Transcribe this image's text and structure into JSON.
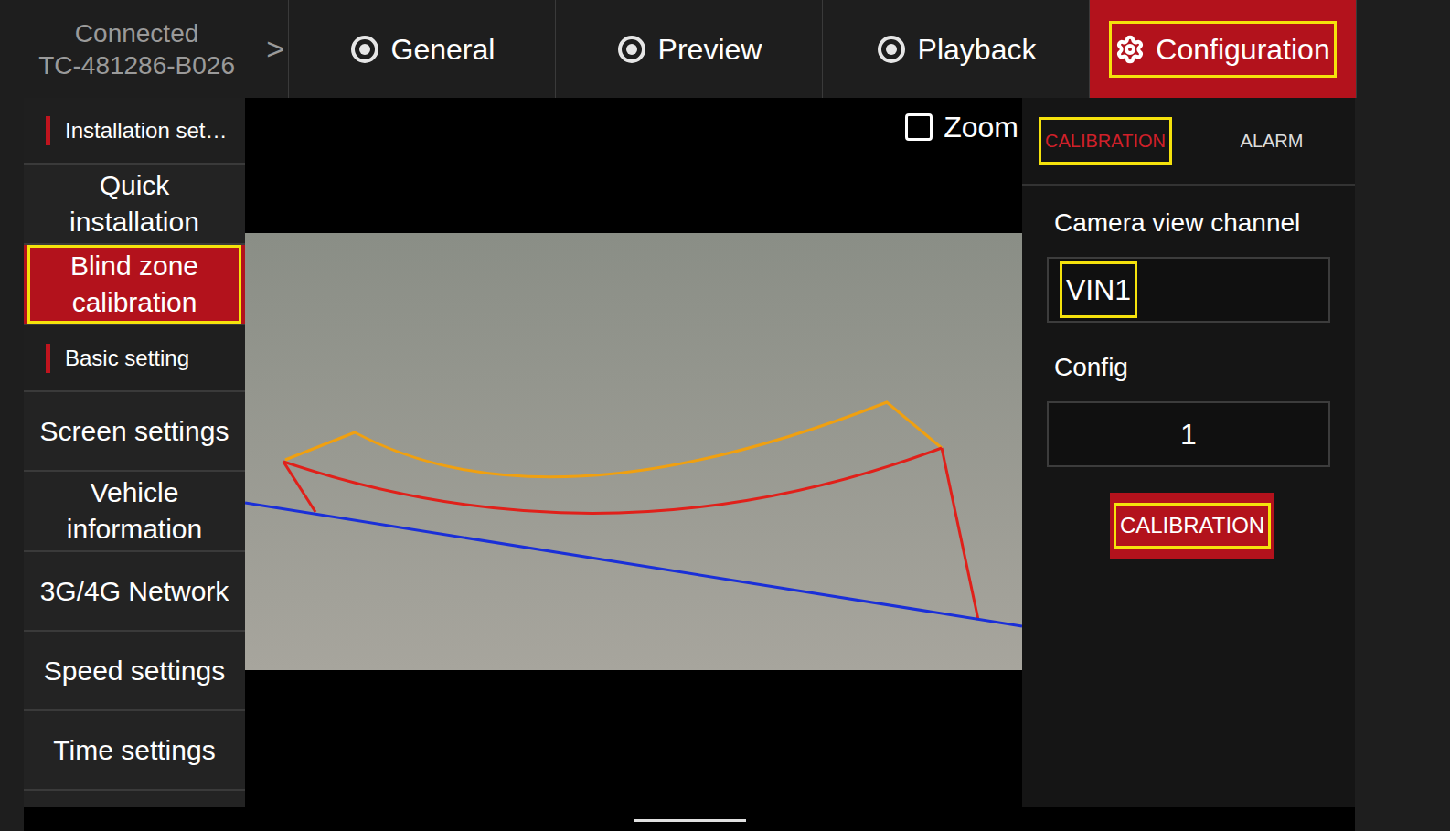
{
  "device": {
    "status": "Connected",
    "id": "TC-481286-B026",
    "chevron": ">"
  },
  "tabs": [
    {
      "label": "General",
      "selected": false,
      "highlighted": false
    },
    {
      "label": "Preview",
      "selected": false,
      "highlighted": false
    },
    {
      "label": "Playback",
      "selected": false,
      "highlighted": false
    },
    {
      "label": "Configuration",
      "selected": true,
      "highlighted": true
    }
  ],
  "sidebar": {
    "items": [
      {
        "label": "Installation set…",
        "kind": "header",
        "selected": false,
        "highlighted": false
      },
      {
        "label": "Quick installation",
        "kind": "item",
        "selected": false,
        "highlighted": false
      },
      {
        "label": "Blind zone calibration",
        "kind": "item",
        "selected": true,
        "highlighted": true
      },
      {
        "label": "Basic setting",
        "kind": "header",
        "selected": false,
        "highlighted": false
      },
      {
        "label": "Screen settings",
        "kind": "item",
        "selected": false,
        "highlighted": false
      },
      {
        "label": "Vehicle information",
        "kind": "item",
        "selected": false,
        "highlighted": false
      },
      {
        "label": "3G/4G Network",
        "kind": "item",
        "selected": false,
        "highlighted": false
      },
      {
        "label": "Speed settings",
        "kind": "item",
        "selected": false,
        "highlighted": false
      },
      {
        "label": "Time settings",
        "kind": "item",
        "selected": false,
        "highlighted": false
      }
    ]
  },
  "preview": {
    "zoom": {
      "label": "Zoom",
      "checked": false
    }
  },
  "panel": {
    "tabs": [
      {
        "label": "CALIBRATION",
        "selected": true,
        "highlighted": true
      },
      {
        "label": "ALARM",
        "selected": false,
        "highlighted": false
      }
    ],
    "fields": [
      {
        "label": "Camera view channel",
        "value": "VIN1",
        "kind": "select",
        "highlighted": true
      },
      {
        "label": "Config",
        "value": "1",
        "kind": "input",
        "highlighted": false
      }
    ],
    "button": {
      "label": "CALIBRATION",
      "highlighted": true
    }
  }
}
